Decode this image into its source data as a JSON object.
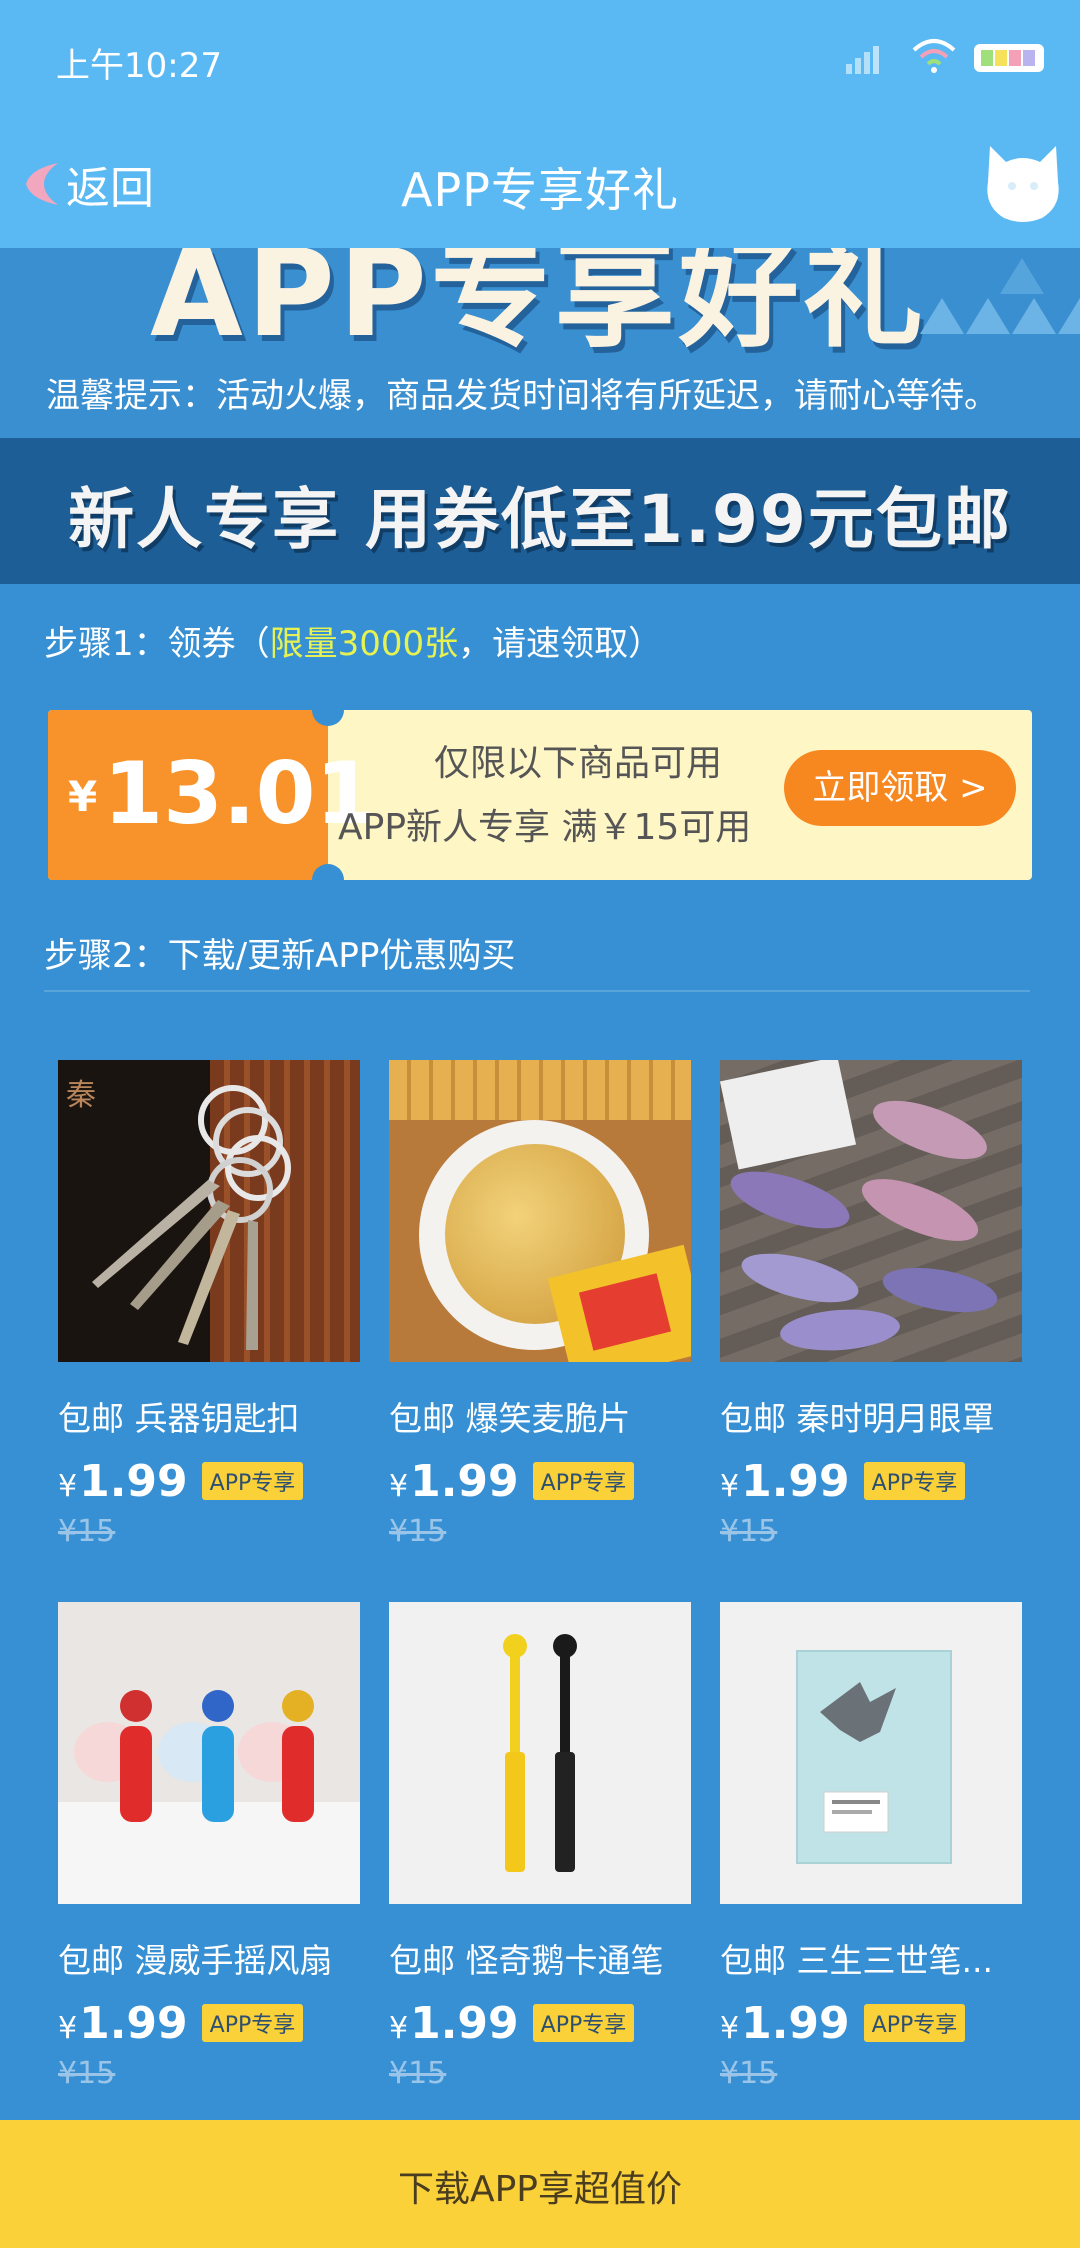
{
  "status_bar": {
    "time": "上午10:27"
  },
  "header": {
    "back_label": "返回",
    "title": "APP专享好礼"
  },
  "banner": {
    "title": "APP专享好礼",
    "tip": "温馨提示：活动火爆，商品发货时间将有所延迟，请耐心等待。"
  },
  "promo": {
    "text": "新人专享  用券低至1.99元包邮"
  },
  "step1": {
    "prefix": "步骤1：领券（",
    "highlight": "限量3000张",
    "suffix": "，请速领取）"
  },
  "coupon": {
    "currency": "¥",
    "amount": "13.01",
    "line1": "仅限以下商品可用",
    "line2": "APP新人专享 满￥15可用",
    "button": "立即领取 >"
  },
  "step2": {
    "text": "步骤2：下载/更新APP优惠购买"
  },
  "products": [
    {
      "name": "包邮 兵器钥匙扣",
      "currency": "¥",
      "price": "1.99",
      "tag": "APP专享",
      "old_price": "¥15"
    },
    {
      "name": "包邮 爆笑麦脆片",
      "currency": "¥",
      "price": "1.99",
      "tag": "APP专享",
      "old_price": "¥15"
    },
    {
      "name": "包邮 秦时明月眼罩",
      "currency": "¥",
      "price": "1.99",
      "tag": "APP专享",
      "old_price": "¥15"
    },
    {
      "name": "包邮 漫威手摇风扇",
      "currency": "¥",
      "price": "1.99",
      "tag": "APP专享",
      "old_price": "¥15"
    },
    {
      "name": "包邮 怪奇鹅卡通笔",
      "currency": "¥",
      "price": "1.99",
      "tag": "APP专享",
      "old_price": "¥15"
    },
    {
      "name": "包邮 三生三世笔...",
      "currency": "¥",
      "price": "1.99",
      "tag": "APP专享",
      "old_price": "¥15"
    }
  ],
  "bottom_bar": {
    "label": "下载APP享超值价"
  },
  "colors": {
    "header": "#5ab8f2",
    "page_bg": "#3790d4",
    "accent_orange": "#f8922a",
    "tag_yellow": "#fbd13a"
  }
}
